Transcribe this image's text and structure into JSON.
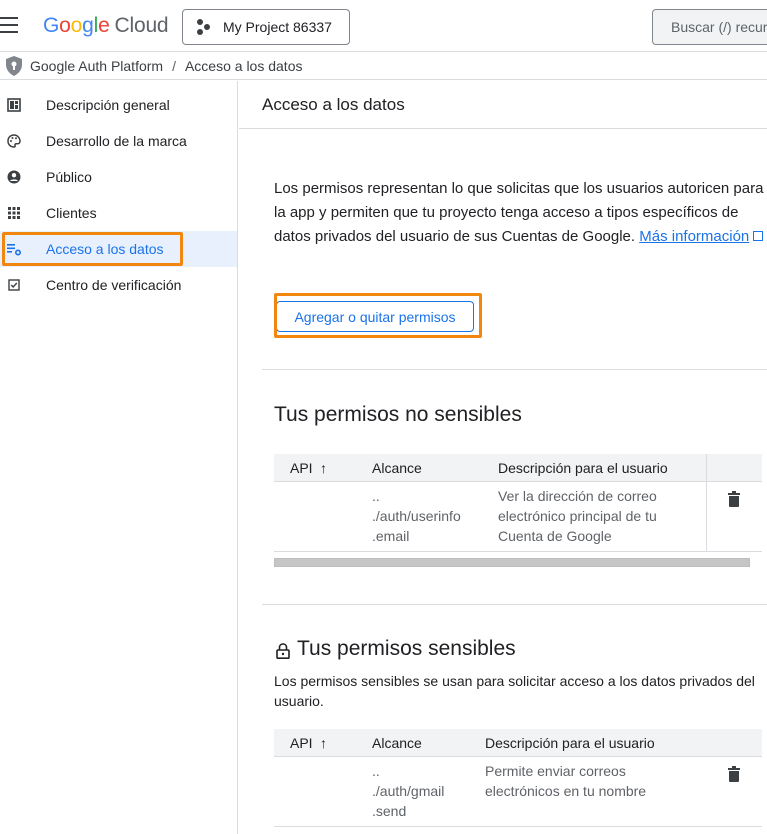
{
  "header": {
    "logo": {
      "letters": [
        "G",
        "o",
        "o",
        "g",
        "l",
        "e"
      ],
      "product": "Cloud"
    },
    "project_label": "My Project 86337",
    "search_placeholder": "Buscar (/) recur"
  },
  "breadcrumb": {
    "root": "Google Auth Platform",
    "separator": "/",
    "current": "Acceso a los datos"
  },
  "sidebar": {
    "items": [
      {
        "label": "Descripción general",
        "icon": "dashboard-icon"
      },
      {
        "label": "Desarrollo de la marca",
        "icon": "palette-icon"
      },
      {
        "label": "Público",
        "icon": "person-circle-icon"
      },
      {
        "label": "Clientes",
        "icon": "grid-icon"
      },
      {
        "label": "Acceso a los datos",
        "icon": "data-access-icon",
        "active": true
      },
      {
        "label": "Centro de verificación",
        "icon": "checkbox-icon"
      }
    ]
  },
  "main": {
    "title": "Acceso a los datos",
    "intro_text": "Los permisos representan lo que solicitas que los usuarios autoricen para la app y permiten que tu proyecto tenga acceso a tipos específicos de datos privados del usuario de sus Cuentas de Google.",
    "learn_more": "Más información",
    "add_remove_button": "Agregar o quitar permisos",
    "non_sensitive": {
      "title": "Tus permisos no sensibles",
      "columns": {
        "api": "API",
        "sort_arrow": "↑",
        "scope": "Alcance",
        "description": "Descripción para el usuario"
      },
      "rows": [
        {
          "scope_lines": [
            "..",
            "./auth/userinfo",
            ".email"
          ],
          "description": "Ver la dirección de correo electrónico principal de tu Cuenta de Google"
        }
      ]
    },
    "sensitive": {
      "title": "Tus permisos sensibles",
      "description": "Los permisos sensibles se usan para solicitar acceso a los datos privados del usuario.",
      "columns": {
        "api": "API",
        "sort_arrow": "↑",
        "scope": "Alcance",
        "description": "Descripción para el usuario"
      },
      "rows": [
        {
          "scope_lines": [
            "..",
            "./auth/gmail",
            ".send"
          ],
          "description": "Permite enviar correos electrónicos en tu nombre"
        }
      ]
    }
  },
  "colors": {
    "accent": "#1a73e8",
    "highlight": "#f2870f",
    "active_bg": "#e8f0fe"
  }
}
